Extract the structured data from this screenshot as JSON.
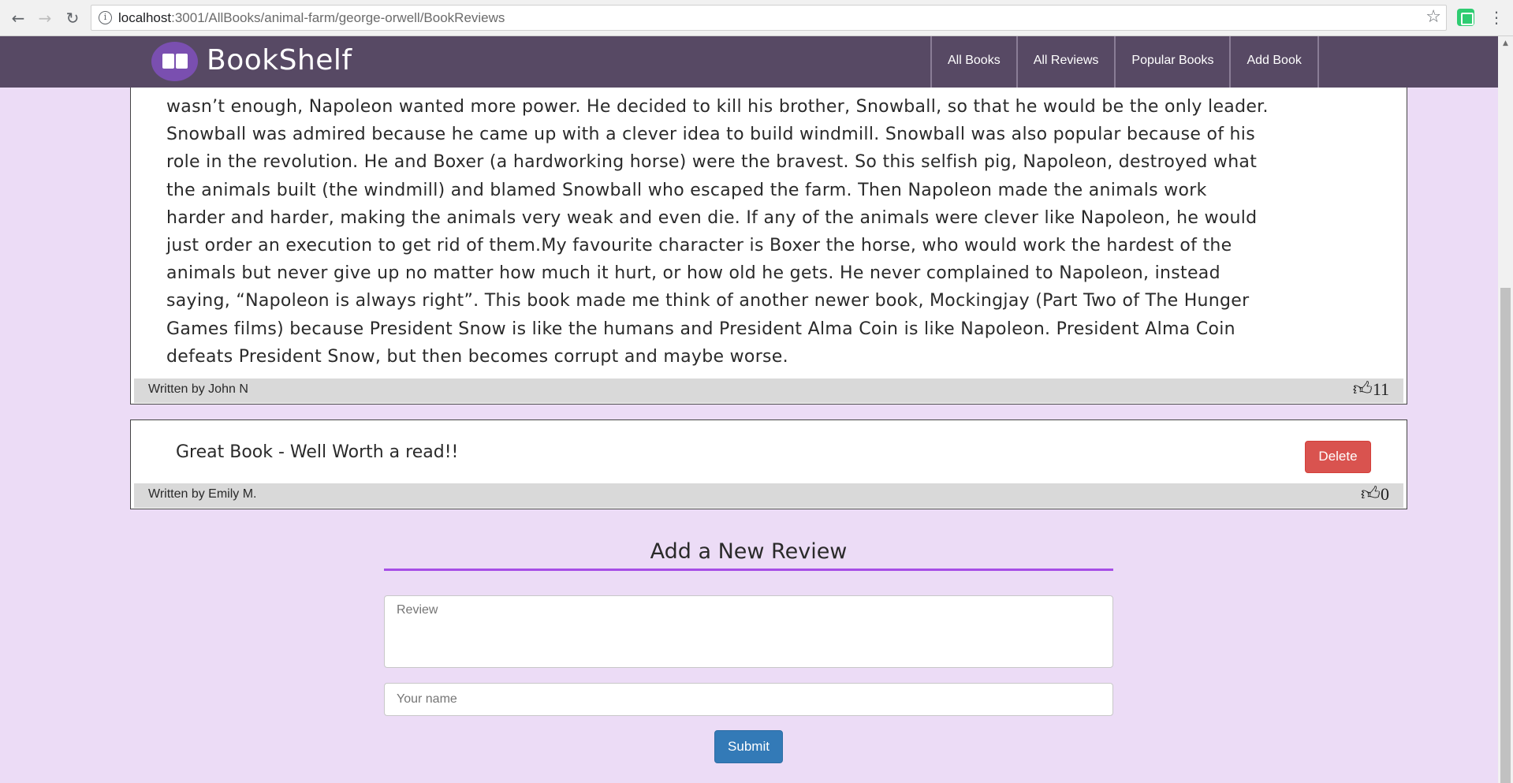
{
  "browser": {
    "url_host": "localhost",
    "url_path": ":3001/AllBooks/animal-farm/george-orwell/BookReviews"
  },
  "navbar": {
    "brand": "BookShelf",
    "items": [
      "All Books",
      "All Reviews",
      "Popular Books",
      "Add Book"
    ]
  },
  "reviews": [
    {
      "lines": [
        "wasn’t enough, Napoleon wanted more power. He decided to kill his brother, Snowball, so that he would be the only leader.",
        "Snowball was admired because he came up with a clever idea to build windmill. Snowball was also popular because of his",
        "role in the revolution. He and Boxer (a hardworking horse) were the bravest. So this selfish pig, Napoleon, destroyed what",
        "the animals built (the windmill) and blamed Snowball who escaped the farm. Then Napoleon made the animals work",
        "harder and harder, making the animals very weak and even die. If any of the animals were clever like Napoleon, he would",
        "just order an execution to get rid of them.My favourite character is Boxer the horse, who would work the hardest of the",
        "animals but never give up no matter how much it hurt, or how old he gets. He never complained to Napoleon, instead",
        "saying, “Napoleon is always right”. This book made me think of another newer book, Mockingjay (Part Two of The Hunger",
        "Games films) because President Snow is like the humans and President Alma Coin is like Napoleon. President Alma Coin",
        "defeats President Snow, but then becomes corrupt and maybe worse."
      ],
      "author": "Written by John N",
      "likes": "11"
    },
    {
      "text": "Great Book - Well Worth a read!!",
      "author": "Written by Emily M.",
      "likes": "0",
      "delete_label": "Delete"
    }
  ],
  "form": {
    "title": "Add a New Review",
    "review_placeholder": "Review",
    "name_placeholder": "Your name",
    "submit_label": "Submit"
  }
}
